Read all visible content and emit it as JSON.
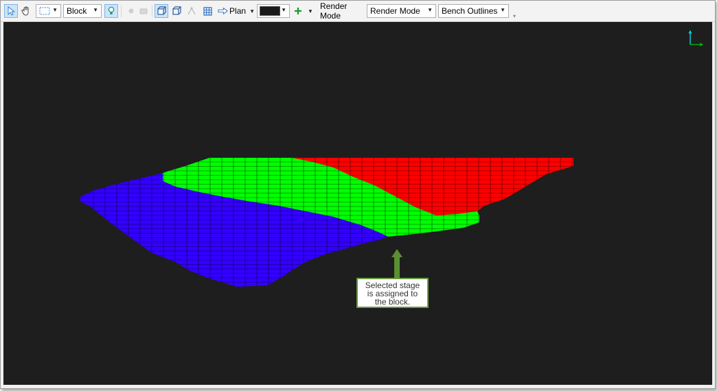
{
  "toolbar": {
    "selection_mode": "Block",
    "view_direction": "Plan",
    "color_swatch": "#1a1a1a",
    "render_mode_label": "Render Mode",
    "render_mode_value": "Render Mode",
    "display_value": "Bench Outlines"
  },
  "viewport": {
    "background": "#1e1e1e",
    "stages": [
      {
        "name": "stage-red",
        "color": "#ff0000"
      },
      {
        "name": "stage-green",
        "color": "#00ff00"
      },
      {
        "name": "stage-blue",
        "color": "#3300ff"
      }
    ],
    "axis_colors": {
      "y": "#00e5ff",
      "x": "#00cc00"
    }
  },
  "callout": {
    "line1": "Selected stage",
    "line2": "is assigned to",
    "line3": "the block.",
    "arrow_color": "#5a8f32",
    "border_color": "#6a9a3f"
  }
}
